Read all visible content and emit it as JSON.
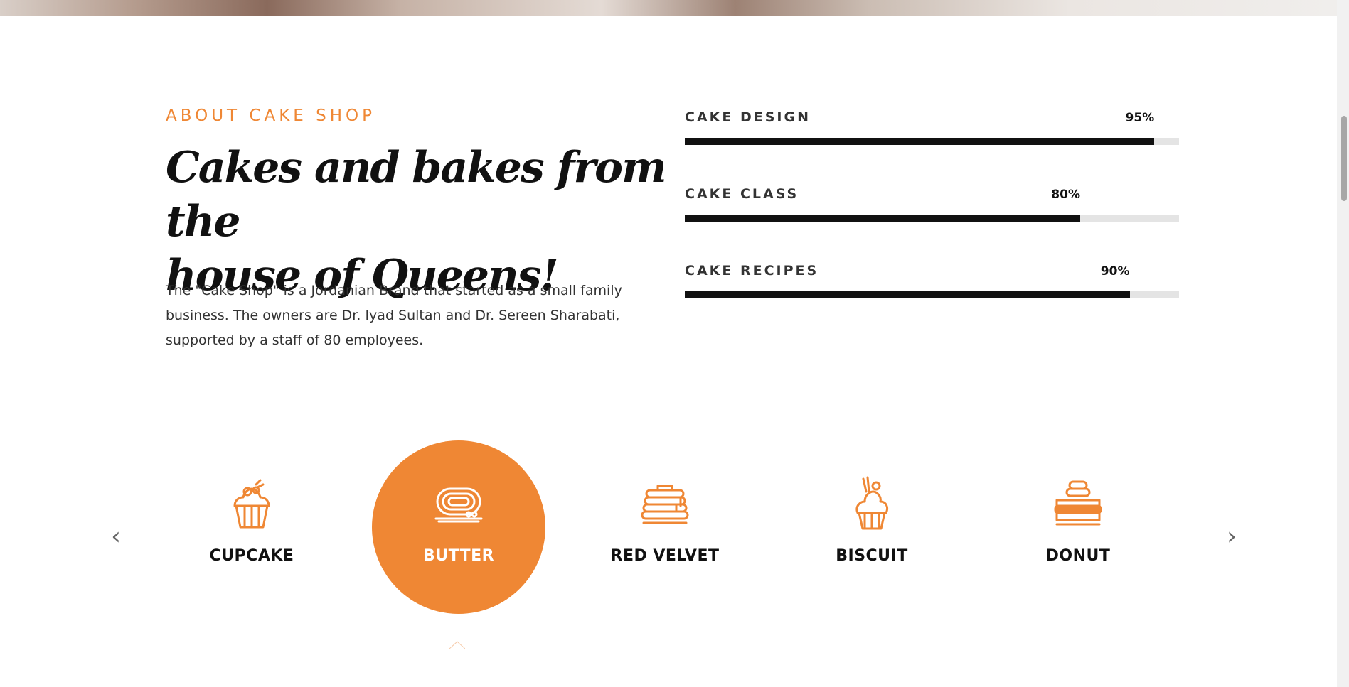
{
  "about": {
    "kicker": "ABOUT CAKE SHOP",
    "title_line1": "Cakes and bakes from the",
    "title_line2": "house of Queens!",
    "body": "The \"Cake Shop\" is a Jordanian Brand that started as a small family business. The owners are Dr. Iyad Sultan and Dr. Sereen Sharabati, supported by a staff of 80 employees."
  },
  "skills": [
    {
      "label": "CAKE DESIGN",
      "percent_text": "95%",
      "value": 95
    },
    {
      "label": "CAKE CLASS",
      "percent_text": "80%",
      "value": 80
    },
    {
      "label": "CAKE RECIPES",
      "percent_text": "90%",
      "value": 90
    }
  ],
  "categories": {
    "items": [
      {
        "label": "CUPCAKE",
        "icon": "cupcake-icon",
        "active": false
      },
      {
        "label": "BUTTER",
        "icon": "roll-cake-icon",
        "active": true
      },
      {
        "label": "RED VELVET",
        "icon": "pancakes-icon",
        "active": false
      },
      {
        "label": "BISCUIT",
        "icon": "sundae-icon",
        "active": false
      },
      {
        "label": "DONUT",
        "icon": "macaron-icon",
        "active": false
      }
    ],
    "prev_icon": "chevron-left-icon",
    "next_icon": "chevron-right-icon"
  },
  "colors": {
    "accent": "#ef8734",
    "text_dark": "#111111",
    "track": "#e4e4e4"
  }
}
